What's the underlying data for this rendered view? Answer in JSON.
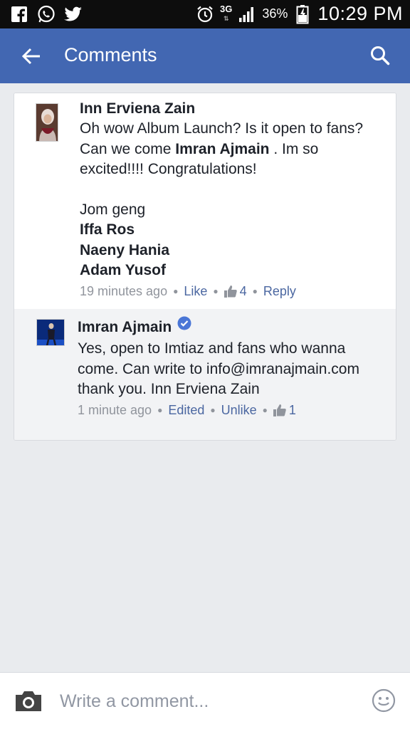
{
  "status_bar": {
    "network": "3G",
    "battery": "36%",
    "time": "10:29 PM"
  },
  "app_bar": {
    "title": "Comments"
  },
  "comments": [
    {
      "author": "Inn Erviena Zain",
      "text_part1": "Oh wow Album Launch? Is it open to fans? Can we come ",
      "mention_main": "Imran Ajmain",
      "text_part2": " . Im so excited!!!!  Congratulations!",
      "text_line2": "Jom geng",
      "mentions": [
        "Iffa Ros",
        "Naeny Hania",
        "Adam Yusof"
      ],
      "time": "19 minutes ago",
      "like_label": "Like",
      "like_count": "4",
      "reply_label": "Reply"
    },
    {
      "author": "Imran Ajmain",
      "text": "Yes, open to Imtiaz and fans who wanna come. Can write to info@imranajmain.com thank you. Inn Erviena Zain",
      "time": "1 minute ago",
      "edited_label": "Edited",
      "unlike_label": "Unlike",
      "like_count": "1"
    }
  ],
  "composer": {
    "placeholder": "Write a comment..."
  },
  "colors": {
    "brand_blue": "#4267b2",
    "link_blue": "#4b67a1",
    "meta_gray": "#90949c"
  }
}
